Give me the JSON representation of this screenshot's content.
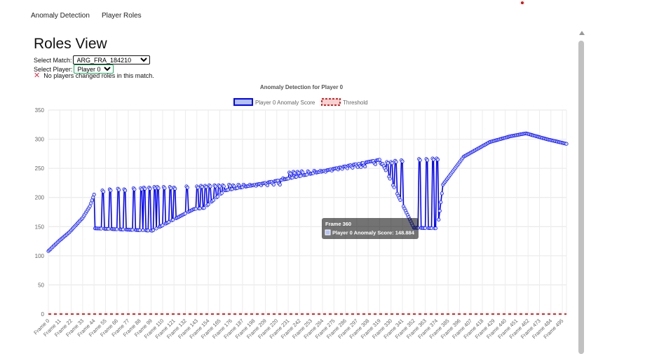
{
  "nav": {
    "items": [
      "Anomaly Detection",
      "Player Roles"
    ]
  },
  "page": {
    "title": "Roles View",
    "match_label": "Select Match:",
    "match_value": "ARG_FRA_184210",
    "player_label": "Select Player:",
    "player_value": "Player 0",
    "status_message": "No players changed roles in this match."
  },
  "colors": {
    "series": "#0000ff",
    "threshold": "#e02020",
    "status_icon": "#e0324b"
  },
  "chart_data": {
    "type": "line",
    "title": "Anomaly Detection for Player 0",
    "legend": [
      "Player 0 Anomaly Score",
      "Threshold"
    ],
    "legend_position": "top",
    "ylim": [
      0,
      350
    ],
    "yticks": [
      0,
      50,
      100,
      150,
      200,
      250,
      300,
      350
    ],
    "xtick_labels": [
      "Frame 0",
      "Frame 11",
      "Frame 22",
      "Frame 33",
      "Frame 44",
      "Frame 55",
      "Frame 66",
      "Frame 77",
      "Frame 88",
      "Frame 99",
      "Frame 110",
      "Frame 121",
      "Frame 132",
      "Frame 143",
      "Frame 154",
      "Frame 165",
      "Frame 176",
      "Frame 187",
      "Frame 198",
      "Frame 209",
      "Frame 220",
      "Frame 231",
      "Frame 242",
      "Frame 253",
      "Frame 264",
      "Frame 275",
      "Frame 286",
      "Frame 297",
      "Frame 308",
      "Frame 319",
      "Frame 330",
      "Frame 341",
      "Frame 352",
      "Frame 363",
      "Frame 374",
      "Frame 385",
      "Frame 396",
      "Frame 407",
      "Frame 418",
      "Frame 429",
      "Frame 440",
      "Frame 451",
      "Frame 462",
      "Frame 473",
      "Frame 484",
      "Frame 495"
    ],
    "frame_count": 500,
    "grid": true,
    "series": [
      {
        "name": "Player 0 Anomaly Score",
        "keypoints": [
          [
            0,
            108
          ],
          [
            10,
            125
          ],
          [
            20,
            140
          ],
          [
            33,
            165
          ],
          [
            40,
            185
          ],
          [
            44,
            205
          ],
          [
            45,
            147
          ],
          [
            100,
            143
          ],
          [
            140,
            180
          ],
          [
            150,
            182
          ],
          [
            170,
            212
          ],
          [
            230,
            232
          ],
          [
            290,
            255
          ],
          [
            320,
            265
          ],
          [
            352,
            148
          ],
          [
            375,
            147
          ],
          [
            380,
            222
          ],
          [
            400,
            270
          ],
          [
            425,
            295
          ],
          [
            445,
            305
          ],
          [
            460,
            310
          ],
          [
            480,
            300
          ],
          [
            499,
            292
          ]
        ],
        "spikes": [
          {
            "frame": 52,
            "value": 212
          },
          {
            "frame": 59,
            "value": 214
          },
          {
            "frame": 67,
            "value": 215
          },
          {
            "frame": 73,
            "value": 214
          },
          {
            "frame": 82,
            "value": 216
          },
          {
            "frame": 89,
            "value": 216
          },
          {
            "frame": 92,
            "value": 217
          },
          {
            "frame": 97,
            "value": 217
          },
          {
            "frame": 102,
            "value": 218
          },
          {
            "frame": 105,
            "value": 218
          },
          {
            "frame": 111,
            "value": 218
          },
          {
            "frame": 117,
            "value": 218
          },
          {
            "frame": 121,
            "value": 217
          },
          {
            "frame": 133,
            "value": 219
          },
          {
            "frame": 143,
            "value": 219
          },
          {
            "frame": 147,
            "value": 220
          },
          {
            "frame": 151,
            "value": 220
          },
          {
            "frame": 155,
            "value": 221
          },
          {
            "frame": 160,
            "value": 221
          },
          {
            "frame": 164,
            "value": 221
          },
          {
            "frame": 168,
            "value": 221
          },
          {
            "frame": 174,
            "value": 222
          },
          {
            "frame": 178,
            "value": 221
          },
          {
            "frame": 183,
            "value": 222
          },
          {
            "frame": 188,
            "value": 222
          },
          {
            "frame": 194,
            "value": 222
          },
          {
            "frame": 199,
            "value": 222
          },
          {
            "frame": 204,
            "value": 223
          },
          {
            "frame": 210,
            "value": 223
          },
          {
            "frame": 216,
            "value": 224
          },
          {
            "frame": 222,
            "value": 224
          },
          {
            "frame": 226,
            "value": 233
          },
          {
            "frame": 232,
            "value": 243
          },
          {
            "frame": 236,
            "value": 244
          },
          {
            "frame": 240,
            "value": 244
          },
          {
            "frame": 244,
            "value": 245
          },
          {
            "frame": 250,
            "value": 245
          },
          {
            "frame": 256,
            "value": 246
          },
          {
            "frame": 262,
            "value": 246
          },
          {
            "frame": 266,
            "value": 246
          },
          {
            "frame": 272,
            "value": 248
          },
          {
            "frame": 278,
            "value": 250
          },
          {
            "frame": 282,
            "value": 251
          },
          {
            "frame": 287,
            "value": 252
          },
          {
            "frame": 292,
            "value": 253
          },
          {
            "frame": 297,
            "value": 254
          },
          {
            "frame": 300,
            "value": 254
          },
          {
            "frame": 304,
            "value": 255
          },
          {
            "frame": 314,
            "value": 259
          },
          {
            "frame": 320,
            "value": 259
          },
          {
            "frame": 326,
            "value": 261
          },
          {
            "frame": 330,
            "value": 261
          },
          {
            "frame": 334,
            "value": 263
          },
          {
            "frame": 340,
            "value": 264
          },
          {
            "frame": 357,
            "value": 266
          },
          {
            "frame": 364,
            "value": 266
          },
          {
            "frame": 370,
            "value": 267
          },
          {
            "frame": 374,
            "value": 267
          }
        ]
      },
      {
        "name": "Threshold",
        "value": 0
      }
    ],
    "tooltip": {
      "title": "Frame 360",
      "label": "Player 0 Anomaly Score: 148.884",
      "frame": 360,
      "value": 148.884
    }
  }
}
